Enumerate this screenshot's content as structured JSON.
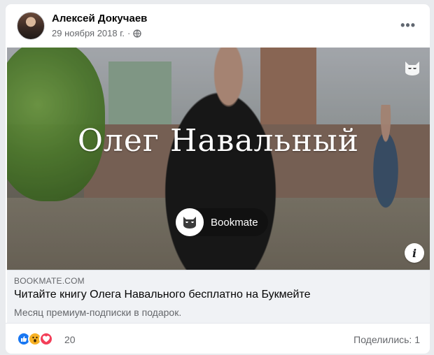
{
  "post": {
    "author_name": "Алексей Докучаев",
    "date": "29 ноября 2018 г.",
    "separator": "·",
    "more_label": "•••"
  },
  "media": {
    "headline": "Олег Навальный",
    "brand_label": "Bookmate",
    "info_label": "i"
  },
  "link_preview": {
    "domain": "BOOKMATE.COM",
    "title": "Читайте книгу Олега Навального бесплатно на Букмейте",
    "description": "Месяц премиум-подписки в подарок."
  },
  "footer": {
    "reactions": [
      "like-icon",
      "wow-icon",
      "love-icon"
    ],
    "reaction_count": "20",
    "shares_label": "Поделились: 1"
  },
  "colors": {
    "facebook_blue": "#1877f2",
    "wow_yellow": "#f7b125",
    "love_red": "#f33e58",
    "secondary_text": "#65676b"
  }
}
